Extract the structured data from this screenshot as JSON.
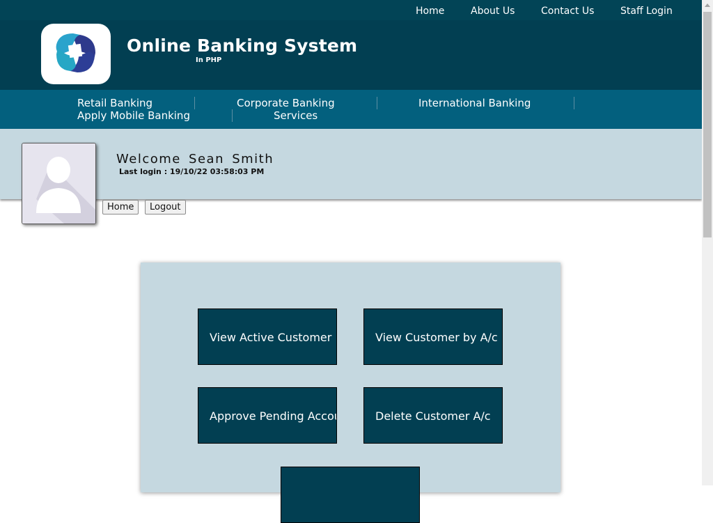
{
  "topnav": {
    "links": [
      "Home",
      "About Us",
      "Contact Us",
      "Staff Login"
    ]
  },
  "header": {
    "title": "Online Banking System",
    "subtitle": "In PHP"
  },
  "mainnav": {
    "items": [
      "Retail Banking",
      "Corporate Banking",
      "International Banking",
      "Apply Mobile Banking",
      "Services"
    ]
  },
  "user": {
    "welcome": "Welcome Sean Smith",
    "last_login": "Last login : 19/10/22 03:58:03 PM"
  },
  "actions": {
    "home": "Home",
    "logout": "Logout"
  },
  "tiles": [
    "View Active Customer",
    "View Customer by A/c",
    "Approve Pending Account",
    "Delete Customer A/c",
    ""
  ],
  "colors": {
    "dark_teal": "#023f52",
    "nav_teal": "#03607e",
    "light_band": "#c5d8e0"
  },
  "icons": [
    "app-logo",
    "user-avatar-icon"
  ]
}
